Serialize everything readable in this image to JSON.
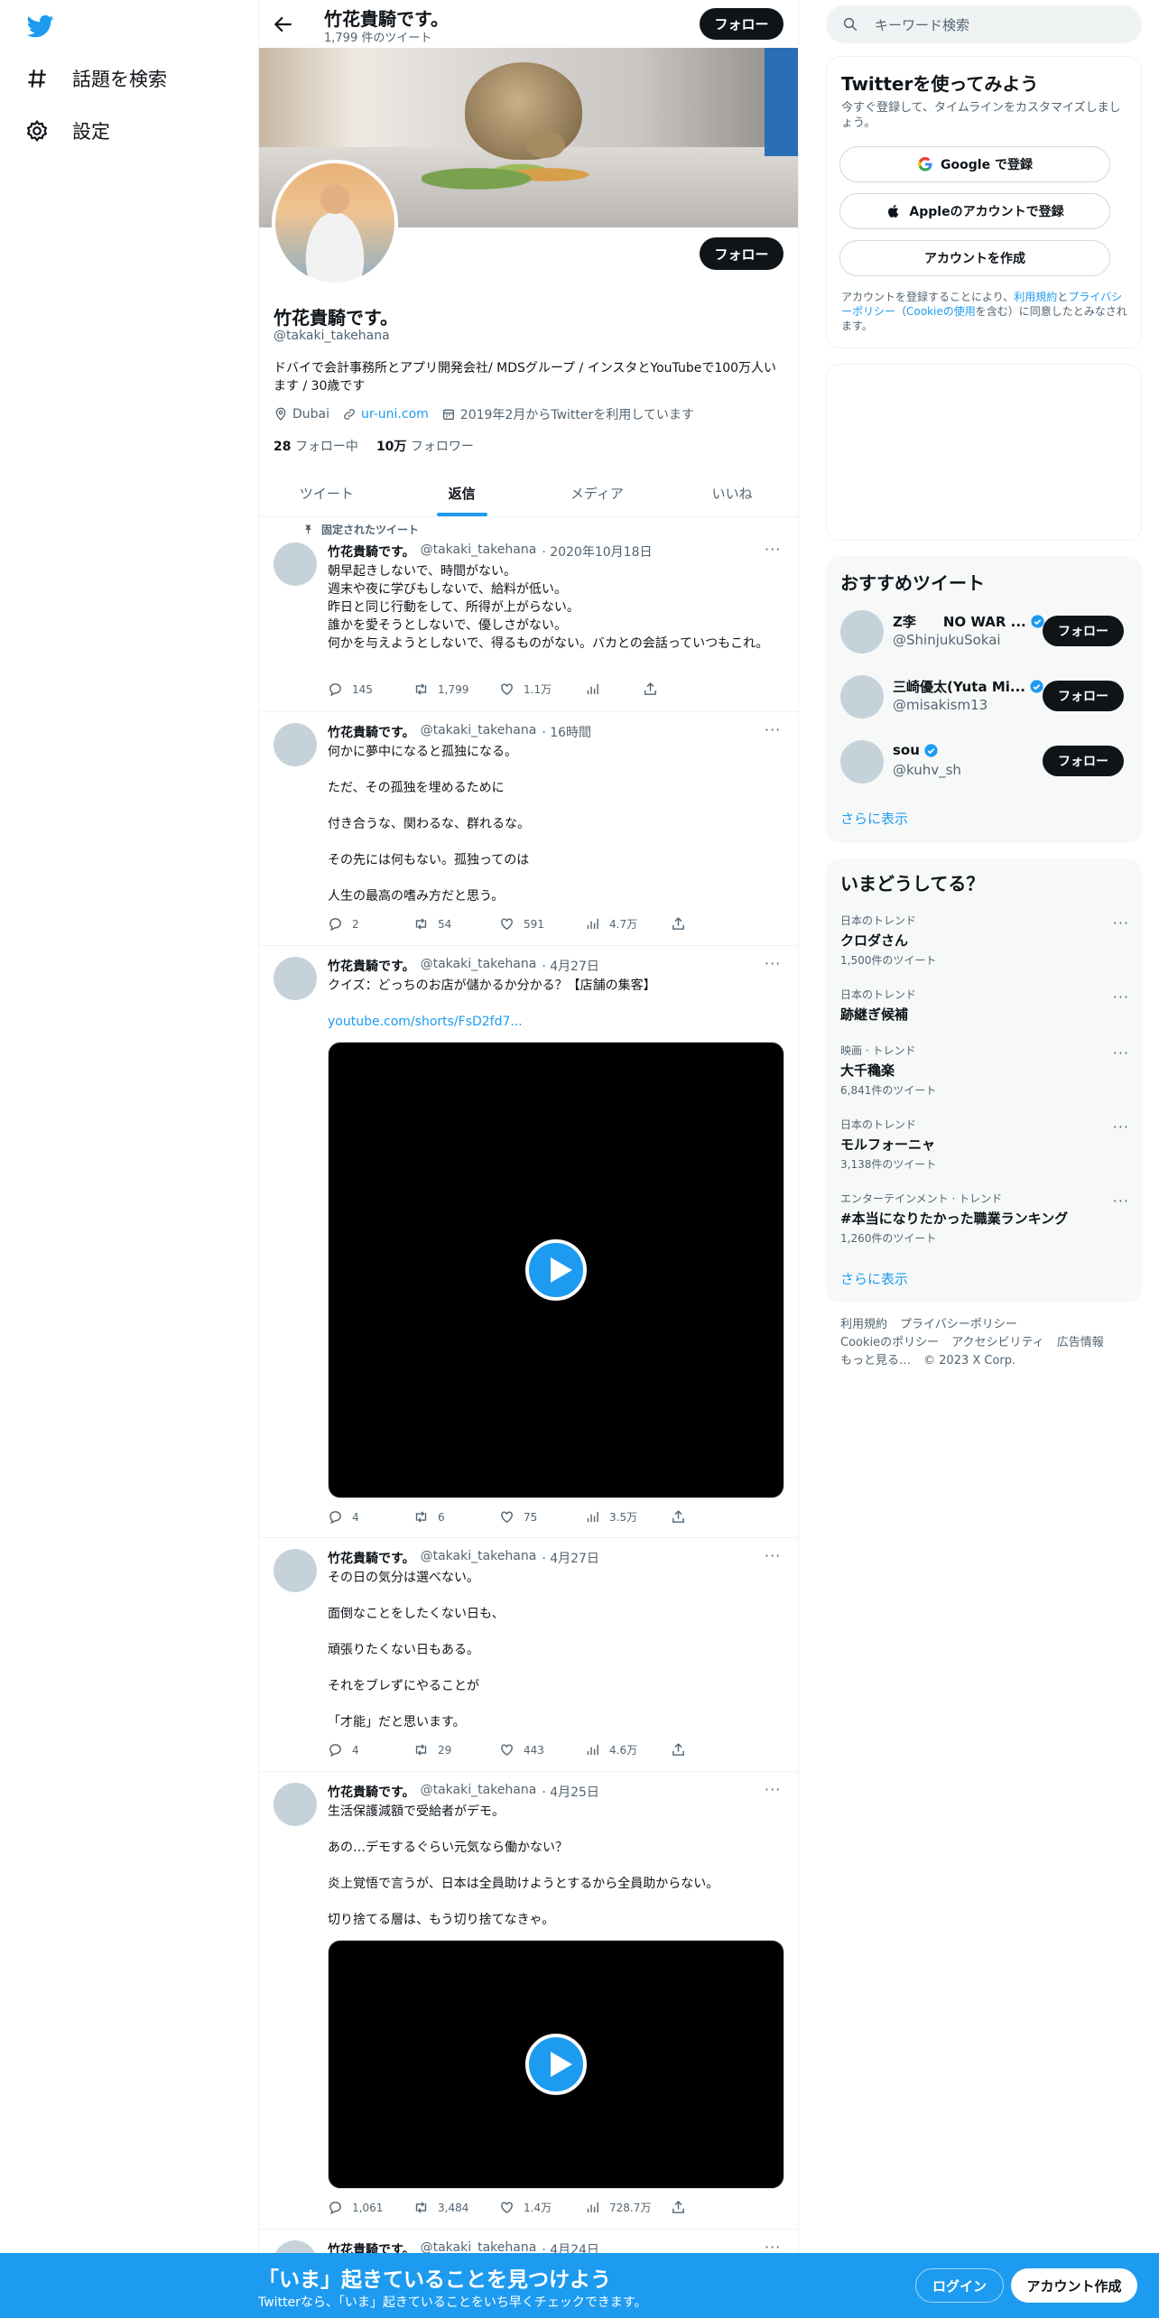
{
  "nav": {
    "explore_label": "話題を検索",
    "settings_label": "設定"
  },
  "header": {
    "name": "竹花貴騎です。",
    "tweet_count": "1,799 件のツイート",
    "follow_label": "フォロー"
  },
  "profile": {
    "name": "竹花貴騎です。",
    "handle": "@takaki_takehana",
    "bio": "ドバイで会計事務所とアプリ開発会社/ MDSグループ / インスタとYouTubeで100万人います / 30歳です",
    "location": "Dubai",
    "website": "ur-uni.com",
    "joined": "2019年2月からTwitterを利用しています",
    "following_count": "28",
    "following_label": "フォロー中",
    "followers_count": "10万",
    "followers_label": "フォロワー",
    "follow_label": "フォロー"
  },
  "tabs": [
    "ツイート",
    "返信",
    "メディア",
    "いいね"
  ],
  "active_tab": "返信",
  "pinned_label": "固定されたツイート",
  "tweets": [
    {
      "name": "竹花貴騎です。",
      "handle": "@takaki_takehana",
      "time": "· 2020年10月18日",
      "text": "朝早起きしないで、時間がない。\n週末や夜に学びもしないで、給料が低い。\n昨日と同じ行動をして、所得が上がらない。\n誰かを愛そうとしないで、優しさがない。\n何かを与えようとしないで、得るものがない。バカとの会話っていつもこれ。",
      "replies": "145",
      "retweets": "1,799",
      "likes": "1.1万",
      "views": ""
    },
    {
      "name": "竹花貴騎です。",
      "handle": "@takaki_takehana",
      "time": "· 16時間",
      "text": "何かに夢中になると孤独になる。\n\nただ、その孤独を埋めるために\n\n付き合うな、関わるな、群れるな。\n\nその先には何もない。孤独ってのは\n\n人生の最高の嗜み方だと思う。",
      "replies": "2",
      "retweets": "54",
      "likes": "591",
      "views": "4.7万"
    },
    {
      "name": "竹花貴騎です。",
      "handle": "@takaki_takehana",
      "time": "· 4月27日",
      "text": "クイズ：どっちのお店が儲かるか分かる？【店舗の集客】",
      "link": "youtube.com/shorts/FsD2fd7...",
      "replies": "4",
      "retweets": "6",
      "likes": "75",
      "views": "3.5万"
    },
    {
      "name": "竹花貴騎です。",
      "handle": "@takaki_takehana",
      "time": "· 4月27日",
      "text": "その日の気分は選べない。\n\n面倒なことをしたくない日も、\n\n頑張りたくない日もある。\n\nそれをブレずにやることが\n\n「才能」だと思います。",
      "replies": "4",
      "retweets": "29",
      "likes": "443",
      "views": "4.6万"
    },
    {
      "name": "竹花貴騎です。",
      "handle": "@takaki_takehana",
      "time": "· 4月25日",
      "text": "生活保護減額で受給者がデモ。\n\nあの…デモするぐらい元気なら働かない？\n\n炎上覚悟で言うが、日本は全員助けようとするから全員助からない。\n\n切り捨てる層は、もう切り捨てなきゃ。",
      "replies": "1,061",
      "retweets": "3,484",
      "likes": "1.4万",
      "views": "728.7万"
    },
    {
      "name": "竹花貴騎です。",
      "handle": "@takaki_takehana",
      "time": "· 4月24日"
    }
  ],
  "search": {
    "placeholder": "キーワード検索"
  },
  "signup": {
    "title": "Twitterを使ってみよう",
    "subtitle": "今すぐ登録して、タイムラインをカスタマイズしましょう。",
    "google": "Google で登録",
    "apple": "Appleのアカウントで登録",
    "create": "アカウントを作成",
    "terms_a": "アカウントを登録することにより、",
    "terms_link1": "利用規約",
    "terms_b": "と",
    "terms_link2": "プライバシーポリシー",
    "terms_c": "（",
    "terms_link3": "Cookieの使用",
    "terms_d": "を含む）に同意したとみなされます。"
  },
  "recommend": {
    "title": "おすすめツイート",
    "users": [
      {
        "name": "Z李　　NO WAR ...",
        "handle": "@ShinjukuSokai",
        "follow": "フォロー"
      },
      {
        "name": "三崎優太(Yuta Mi...",
        "handle": "@misakism13",
        "follow": "フォロー"
      },
      {
        "name": "sou",
        "handle": "@kuhv_sh",
        "follow": "フォロー"
      }
    ],
    "more": "さらに表示"
  },
  "trends": {
    "title": "いまどうしてる？",
    "items": [
      {
        "context": "日本のトレンド",
        "topic": "クロダさん",
        "count": "1,500件のツイート"
      },
      {
        "context": "日本のトレンド",
        "topic": "跡継ぎ候補",
        "count": ""
      },
      {
        "context": "映画 · トレンド",
        "topic": "大千穐楽",
        "count": "6,841件のツイート"
      },
      {
        "context": "日本のトレンド",
        "topic": "モルフォーニャ",
        "count": "3,138件のツイート"
      },
      {
        "context": "エンターテインメント · トレンド",
        "topic": "#本当になりたかった職業ランキング",
        "count": "1,260件のツイート"
      }
    ],
    "more": "さらに表示"
  },
  "footer": {
    "links": [
      "利用規約",
      "プライバシーポリシー",
      "Cookieのポリシー",
      "アクセシビリティ",
      "広告情報",
      "もっと見る…",
      "© 2023 X Corp."
    ]
  },
  "bottom_bar": {
    "headline": "「いま」起きていることを見つけよう",
    "sub": "Twitterなら、「いま」起きていることをいち早くチェックできます。",
    "login": "ログイン",
    "signup": "アカウント作成"
  },
  "colors": {
    "accent": "#1d9bf0",
    "text": "#0f1419",
    "muted": "#536471"
  }
}
